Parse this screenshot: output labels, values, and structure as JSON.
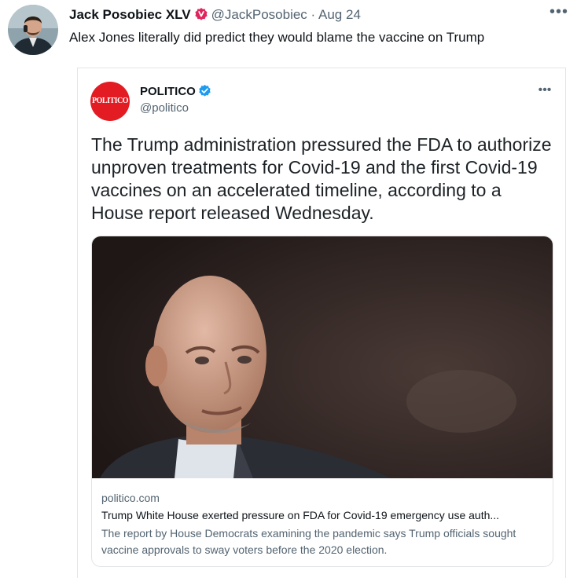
{
  "tweet": {
    "author_name": "Jack Posobiec XLV",
    "handle": "@JackPosobiec",
    "separator": "·",
    "date": "Aug 24",
    "more_icon": "ellipsis-icon",
    "text": "Alex Jones literally did predict they would blame the vaccine on Trump",
    "badge_color": "#e0245e"
  },
  "quoted": {
    "avatar_text": "POLITICO",
    "avatar_color": "#e31b23",
    "name": "POLITICO",
    "handle": "@politico",
    "verified_color": "#1d9bf0",
    "text": "The Trump administration pressured the FDA to authorize unproven treatments for Covid-19 and the first Covid-19 vaccines on an accelerated timeline, according to a House report released Wednesday.",
    "card": {
      "domain": "politico.com",
      "title": "Trump White House exerted pressure on FDA for Covid-19 emergency use auth...",
      "description": "The report by House Democrats examining the pandemic says Trump officials sought vaccine approvals to sway voters before the 2020 election."
    }
  }
}
